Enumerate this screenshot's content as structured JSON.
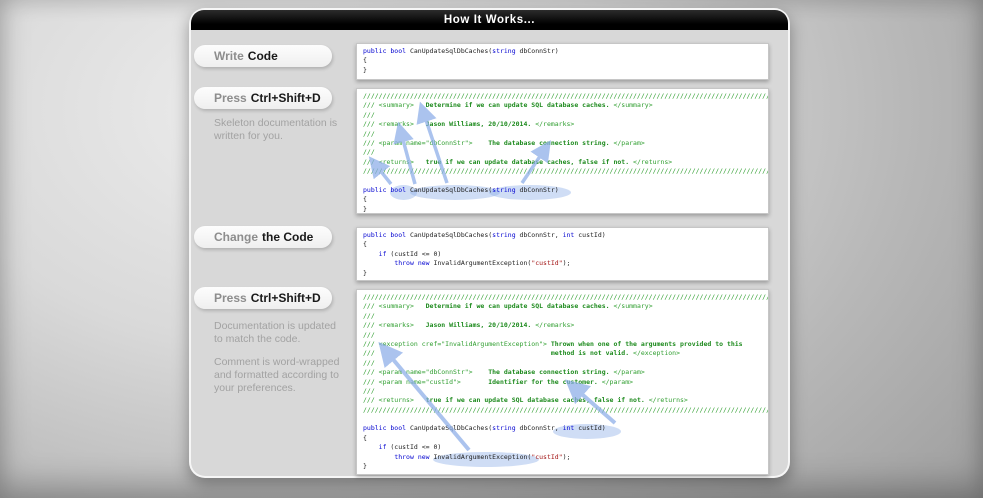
{
  "header": {
    "title": "How It Works..."
  },
  "steps": [
    {
      "muted": "Write",
      "bold": "Code",
      "paras": []
    },
    {
      "muted": "Press",
      "bold": "Ctrl+Shift+D",
      "paras": [
        "Skeleton documentation is written for you."
      ]
    },
    {
      "muted": "Change",
      "bold": "the Code",
      "paras": []
    },
    {
      "muted": "Press",
      "bold": "Ctrl+Shift+D",
      "paras": [
        "Documentation is updated to match the code.",
        "Comment is word-wrapped and formatted according to your preferences."
      ]
    }
  ],
  "colors": {
    "keyword_blue": "#0000d0",
    "comment_green": "#2f9e2f",
    "string_red": "#a31515",
    "highlight_blue": "#8cade8",
    "panel_gray": "#d8d8d8",
    "header_black": "#000000"
  },
  "code_blocks": [
    {
      "lines": [
        [
          [
            "k",
            "public bool "
          ],
          [
            "p",
            "CanUpdateSqlDbCaches("
          ],
          [
            "k",
            "string"
          ],
          [
            "p",
            " dbConnStr)"
          ]
        ],
        [
          [
            "p",
            "{"
          ]
        ],
        [
          [
            "p",
            "}"
          ]
        ]
      ]
    },
    {
      "lines": [
        [
          [
            "g",
            "////////////////////////////////////////////////////////////////////////////////////////////////////////"
          ]
        ],
        [
          [
            "g",
            "/// <summary>   "
          ],
          [
            "gb",
            "Determine if we can update SQL database caches. "
          ],
          [
            "g",
            "</summary>"
          ]
        ],
        [
          [
            "g",
            "///"
          ]
        ],
        [
          [
            "g",
            "/// <remarks>   "
          ],
          [
            "gb",
            "Jason Williams, 20/10/2014. "
          ],
          [
            "g",
            "</remarks>"
          ]
        ],
        [
          [
            "g",
            "///"
          ]
        ],
        [
          [
            "g",
            "/// <param name=\"dbConnStr\">    "
          ],
          [
            "gb",
            "The database connection string. "
          ],
          [
            "g",
            "</param>"
          ]
        ],
        [
          [
            "g",
            "///"
          ]
        ],
        [
          [
            "g",
            "/// <returns>   "
          ],
          [
            "gb",
            "true if we can update database caches, false if not. "
          ],
          [
            "g",
            "</returns>"
          ]
        ],
        [
          [
            "g",
            "////////////////////////////////////////////////////////////////////////////////////////////////////////"
          ]
        ],
        [
          [
            "p",
            ""
          ]
        ],
        [
          [
            "k",
            "public bool "
          ],
          [
            "p",
            "CanUpdateSqlDbCaches("
          ],
          [
            "k",
            "string"
          ],
          [
            "p",
            " dbConnStr)"
          ]
        ],
        [
          [
            "p",
            "{"
          ]
        ],
        [
          [
            "p",
            "}"
          ]
        ]
      ]
    },
    {
      "lines": [
        [
          [
            "k",
            "public bool "
          ],
          [
            "p",
            "CanUpdateSqlDbCaches("
          ],
          [
            "k",
            "string"
          ],
          [
            "p",
            " dbConnStr, "
          ],
          [
            "k",
            "int"
          ],
          [
            "p",
            " custId)"
          ]
        ],
        [
          [
            "p",
            "{"
          ]
        ],
        [
          [
            "p",
            "    "
          ],
          [
            "k",
            "if"
          ],
          [
            "p",
            " (custId <= 0)"
          ]
        ],
        [
          [
            "p",
            "        "
          ],
          [
            "k",
            "throw"
          ],
          [
            "p",
            " "
          ],
          [
            "k",
            "new"
          ],
          [
            "p",
            " InvalidArgumentException("
          ],
          [
            "s",
            "\"custId\""
          ],
          [
            "p",
            ");"
          ]
        ],
        [
          [
            "p",
            "}"
          ]
        ]
      ]
    },
    {
      "lines": [
        [
          [
            "g",
            "////////////////////////////////////////////////////////////////////////////////////////////////////////"
          ]
        ],
        [
          [
            "g",
            "/// <summary>   "
          ],
          [
            "gb",
            "Determine if we can update SQL database caches. "
          ],
          [
            "g",
            "</summary>"
          ]
        ],
        [
          [
            "g",
            "///"
          ]
        ],
        [
          [
            "g",
            "/// <remarks>   "
          ],
          [
            "gb",
            "Jason Williams, 20/10/2014. "
          ],
          [
            "g",
            "</remarks>"
          ]
        ],
        [
          [
            "g",
            "///"
          ]
        ],
        [
          [
            "g",
            "/// <exception cref=\"InvalidArgumentException\"> "
          ],
          [
            "gb",
            "Thrown when one of the arguments provided to this"
          ]
        ],
        [
          [
            "g",
            "///"
          ],
          [
            "gb",
            "                                             method is not valid. "
          ],
          [
            "g",
            "</exception>"
          ]
        ],
        [
          [
            "g",
            "///"
          ]
        ],
        [
          [
            "g",
            "/// <param name=\"dbConnStr\">    "
          ],
          [
            "gb",
            "The database connection string. "
          ],
          [
            "g",
            "</param>"
          ]
        ],
        [
          [
            "g",
            "/// <param name=\"custId\">       "
          ],
          [
            "gb",
            "Identifier for the customer. "
          ],
          [
            "g",
            "</param>"
          ]
        ],
        [
          [
            "g",
            "///"
          ]
        ],
        [
          [
            "g",
            "/// <returns>   "
          ],
          [
            "gb",
            "true if we can update SQL database caches, false if not. "
          ],
          [
            "g",
            "</returns>"
          ]
        ],
        [
          [
            "g",
            "////////////////////////////////////////////////////////////////////////////////////////////////////////"
          ]
        ],
        [
          [
            "p",
            ""
          ]
        ],
        [
          [
            "k",
            "public bool "
          ],
          [
            "p",
            "CanUpdateSqlDbCaches("
          ],
          [
            "k",
            "string"
          ],
          [
            "p",
            " dbConnStr, "
          ],
          [
            "k",
            "int"
          ],
          [
            "p",
            " custId)"
          ]
        ],
        [
          [
            "p",
            "{"
          ]
        ],
        [
          [
            "p",
            "    "
          ],
          [
            "k",
            "if"
          ],
          [
            "p",
            " (custId <= 0)"
          ]
        ],
        [
          [
            "p",
            "        "
          ],
          [
            "k",
            "throw"
          ],
          [
            "p",
            " "
          ],
          [
            "k",
            "new"
          ],
          [
            "p",
            " InvalidArgumentException("
          ],
          [
            "s",
            "\"custId\""
          ],
          [
            "p",
            ");"
          ]
        ],
        [
          [
            "p",
            "}"
          ]
        ]
      ]
    }
  ]
}
